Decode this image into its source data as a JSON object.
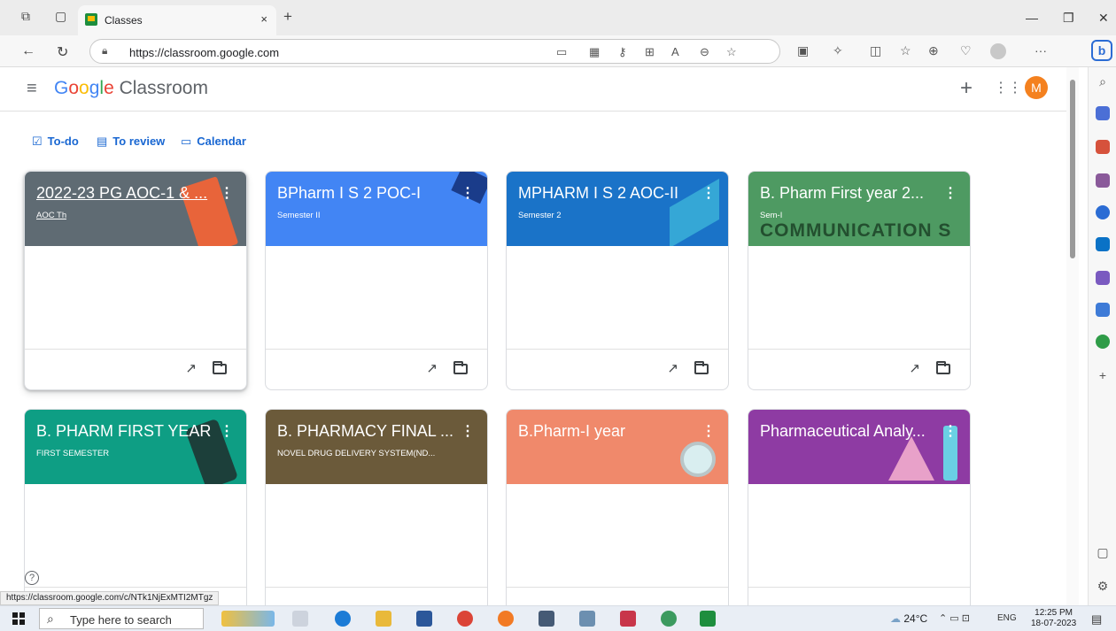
{
  "browser": {
    "tab_title": "Classes",
    "tab_close": "×",
    "new_tab": "+",
    "url": "https://classroom.google.com",
    "more": "···",
    "bing_label": "b"
  },
  "app": {
    "logo_google": [
      "G",
      "o",
      "o",
      "g",
      "l",
      "e"
    ],
    "logo_product": " Classroom",
    "avatar_initial": "M",
    "plus": "+"
  },
  "quicklinks": [
    {
      "label": "To-do",
      "icon": "todo-icon"
    },
    {
      "label": "To review",
      "icon": "review-icon"
    },
    {
      "label": "Calendar",
      "icon": "calendar-icon"
    }
  ],
  "cards": [
    {
      "title": "2022-23 PG AOC-1 & ...",
      "subtitle": "AOC Th",
      "color": "#5f6b73",
      "underline": true
    },
    {
      "title": "BPharm I S 2 POC-I",
      "subtitle": "Semester II",
      "color": "#4285f4"
    },
    {
      "title": "MPHARM I S 2 AOC-II",
      "subtitle": "Semester 2",
      "color": "#1a73c8"
    },
    {
      "title": "B. Pharm First year 2...",
      "subtitle": "Sem-I",
      "color": "#4e9a62",
      "overlay": "COMMUNICATION S"
    },
    {
      "title": "B. PHARM FIRST YEAR",
      "subtitle": "FIRST SEMESTER",
      "color": "#0e9e84"
    },
    {
      "title": "B. PHARMACY FINAL ...",
      "subtitle": "NOVEL DRUG DELIVERY SYSTEM(ND...",
      "color": "#6b5a3a"
    },
    {
      "title": "B.Pharm-I year",
      "subtitle": "",
      "color": "#f0896b"
    },
    {
      "title": "Pharmaceutical Analy...",
      "subtitle": "",
      "color": "#8e3ba3"
    }
  ],
  "status_url": "https://classroom.google.com/c/NTk1NjExMTI2MTgz",
  "help": "?",
  "taskbar": {
    "search_placeholder": "Type here to search",
    "weather": "24°C",
    "lang": "ENG",
    "time": "12:25 PM",
    "date": "18-07-2023"
  }
}
